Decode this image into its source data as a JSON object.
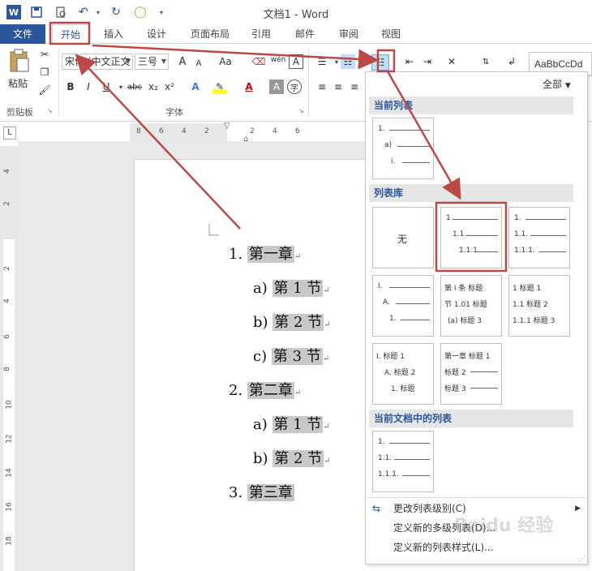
{
  "titlebar": {
    "title": "文档1 - Word",
    "icons": [
      "word-logo-icon",
      "save-icon",
      "print-preview-icon",
      "undo-icon",
      "redo-icon",
      "circle-icon",
      "customize-qat-icon"
    ]
  },
  "tabs": [
    {
      "label": "文件"
    },
    {
      "label": "开始"
    },
    {
      "label": "插入"
    },
    {
      "label": "设计"
    },
    {
      "label": "页面布局"
    },
    {
      "label": "引用"
    },
    {
      "label": "邮件"
    },
    {
      "label": "审阅"
    },
    {
      "label": "视图"
    }
  ],
  "ribbon": {
    "paste_label": "粘贴",
    "clipboard_label": "剪贴板",
    "font_label": "字体",
    "font_name": "宋体 (中文正文",
    "font_size": "三号",
    "bold": "B",
    "italic": "I",
    "underline": "U",
    "strike": "abc",
    "subscript": "x₂",
    "superscript": "x²",
    "grow": "A",
    "shrink": "A",
    "case": "Aa",
    "phonetic": "wén",
    "style_preview": "AaBbCcDd"
  },
  "ruler": {
    "h_ticks": [
      "8",
      "6",
      "4",
      "2",
      "2",
      "4",
      "6"
    ],
    "v_ticks": [
      "4",
      "2",
      "2",
      "4",
      "6",
      "8",
      "10",
      "12",
      "14",
      "16",
      "18"
    ]
  },
  "document": {
    "list": [
      {
        "num": "1.",
        "text": "第一章"
      },
      {
        "num": "a)",
        "text": "第 1 节"
      },
      {
        "num": "b)",
        "text": "第 2 节"
      },
      {
        "num": "c)",
        "text": "第 3 节"
      },
      {
        "num": "2.",
        "text": "第二章"
      },
      {
        "num": "a)",
        "text": "第 1 节"
      },
      {
        "num": "b)",
        "text": "第 2 节"
      },
      {
        "num": "3.",
        "text": "第三章"
      }
    ]
  },
  "dropdown": {
    "filter": "全部",
    "current_list_label": "当前列表",
    "library_label": "列表库",
    "doc_lists_label": "当前文档中的列表",
    "none_label": "无",
    "current_tile": [
      "1.",
      "a)",
      "i."
    ],
    "lib_tile_1": [
      "1",
      "1.1",
      "1.1.1"
    ],
    "lib_tile_2": [
      "1.",
      "1.1.",
      "1.1.1."
    ],
    "lib_tile_3": [
      "I.",
      "A.",
      "1."
    ],
    "lib_tile_4": [
      "第 Ⅰ 条 标题",
      "节 1.01 标题",
      "(a) 标题 3"
    ],
    "lib_tile_5": [
      "1 标题 1",
      "1.1 标题 2",
      "1.1.1 标题 3"
    ],
    "lib_tile_6": [
      "I. 标题 1",
      "A. 标题 2",
      "1. 标题"
    ],
    "lib_tile_7": [
      "第一章 标题 1",
      "标题 2",
      "标题 3"
    ],
    "doc_tile": [
      "1.",
      "1.1.",
      "1.1.1."
    ],
    "menu": [
      "更改列表级别(C)",
      "定义新的多级列表(D)...",
      "定义新的列表样式(L)..."
    ]
  },
  "colors": {
    "accent": "#2b579a",
    "annotation": "#b94a48",
    "highlight": "#c8c8c8"
  }
}
